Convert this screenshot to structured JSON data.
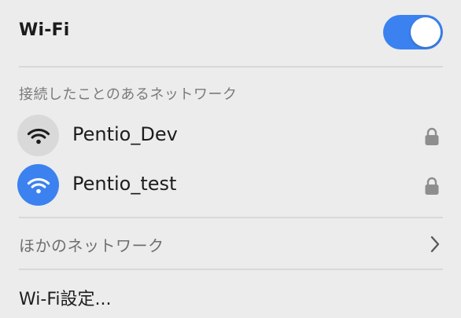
{
  "header": {
    "title": "Wi-Fi",
    "toggle_on": true,
    "toggle_color": "#3b82f0"
  },
  "known_networks": {
    "label": "接続したことのあるネットワーク",
    "items": [
      {
        "name": "Pentio_Dev",
        "connected": false,
        "secured": true,
        "icon": "wifi-icon"
      },
      {
        "name": "Pentio_test",
        "connected": true,
        "secured": true,
        "icon": "wifi-icon"
      }
    ]
  },
  "other_networks": {
    "label": "ほかのネットワーク",
    "icon": "chevron-right-icon"
  },
  "settings": {
    "label": "Wi-Fi設定..."
  }
}
